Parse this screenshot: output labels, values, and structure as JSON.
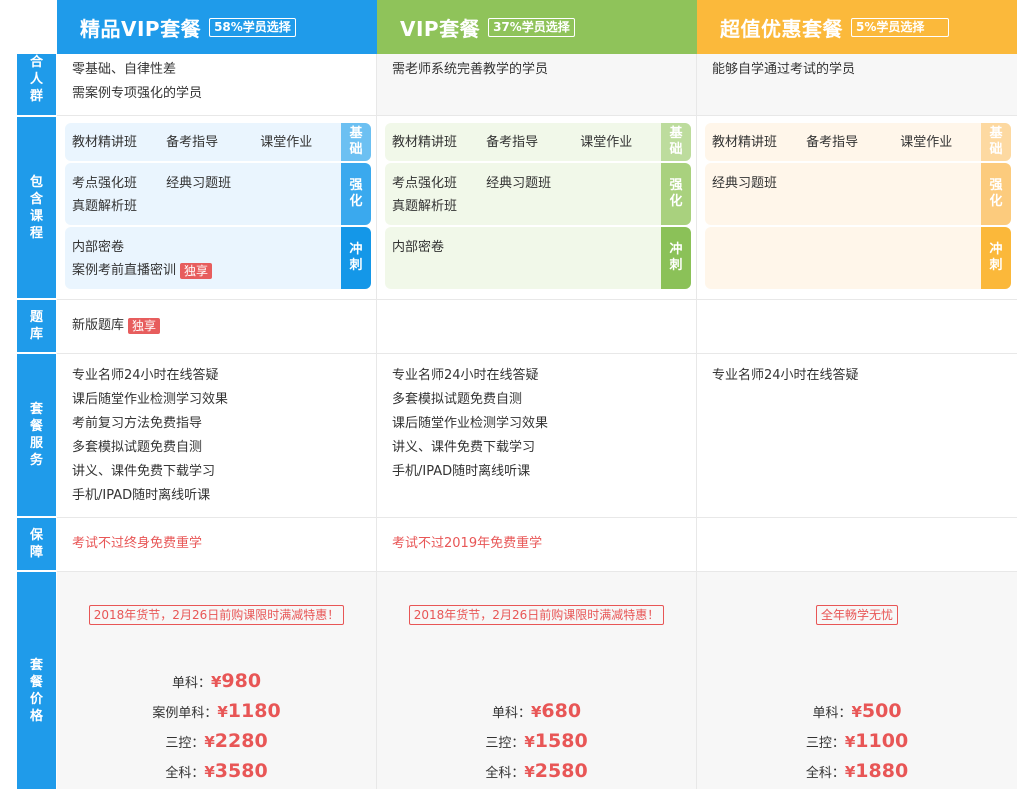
{
  "plans": [
    {
      "title": "精品VIP套餐",
      "pct": "58%学员选择"
    },
    {
      "title": "VIP套餐",
      "pct": "37%学员选择"
    },
    {
      "title": "超值优惠套餐",
      "pct": "5%学员选择"
    }
  ],
  "rows": {
    "audience": "合人群",
    "courses": "包含课程",
    "bank": "题库",
    "service": "套餐服务",
    "guarantee": "保障",
    "price": "套餐价格"
  },
  "audience": [
    [
      "零基础、自律性差",
      "需案例专项强化的学员"
    ],
    [
      "需老师系统完善教学的学员"
    ],
    [
      "能够自学通过考试的学员"
    ]
  ],
  "tags": {
    "basic": "基础",
    "strong": "强化",
    "sprint": "冲刺"
  },
  "courses": [
    {
      "basic": [
        "教材精讲班",
        "备考指导",
        "课堂作业"
      ],
      "strong": [
        "考点强化班",
        "经典习题班",
        "真题解析班"
      ],
      "sprint": [
        "内部密卷",
        "案例考前直播密训"
      ]
    },
    {
      "basic": [
        "教材精讲班",
        "备考指导",
        "课堂作业"
      ],
      "strong": [
        "考点强化班",
        "经典习题班",
        "真题解析班"
      ],
      "sprint": [
        "内部密卷"
      ]
    },
    {
      "basic": [
        "教材精讲班",
        "备考指导",
        "课堂作业"
      ],
      "strong": [
        "经典习题班"
      ],
      "sprint": []
    }
  ],
  "exclusive": "独享",
  "bank": [
    "新版题库",
    "",
    ""
  ],
  "services": [
    [
      "专业名师24小时在线答疑",
      "课后随堂作业检测学习效果",
      "考前复习方法免费指导",
      "多套模拟试题免费自测",
      "讲义、课件免费下载学习",
      "手机/IPAD随时离线听课"
    ],
    [
      "专业名师24小时在线答疑",
      "多套模拟试题免费自测",
      "课后随堂作业检测学习效果",
      "讲义、课件免费下载学习",
      "手机/IPAD随时离线听课"
    ],
    [
      "专业名师24小时在线答疑"
    ]
  ],
  "guarantee": [
    "考试不过终身免费重学",
    "考试不过2019年免费重学",
    ""
  ],
  "promo": [
    "2018年货节，2月26日前购课限时满减特惠！",
    "2018年货节，2月26日前购课限时满减特惠！",
    "全年畅学无忧"
  ],
  "currency": "¥",
  "prices": [
    [
      {
        "label": "单科：",
        "value": "980"
      },
      {
        "label": "案例单科：",
        "value": "1180"
      },
      {
        "label": "三控：",
        "value": "2280"
      },
      {
        "label": "全科：",
        "value": "3580"
      }
    ],
    [
      {
        "label": "单科：",
        "value": "680"
      },
      {
        "label": "三控：",
        "value": "1580"
      },
      {
        "label": "全科：",
        "value": "2580"
      }
    ],
    [
      {
        "label": "单科：",
        "value": "500"
      },
      {
        "label": "三控：",
        "value": "1100"
      },
      {
        "label": "全科：",
        "value": "1880"
      }
    ]
  ],
  "colors": {
    "blue": "#1f9bea",
    "green": "#8fc35a",
    "orange": "#fbb93b",
    "red": "#e85656"
  }
}
